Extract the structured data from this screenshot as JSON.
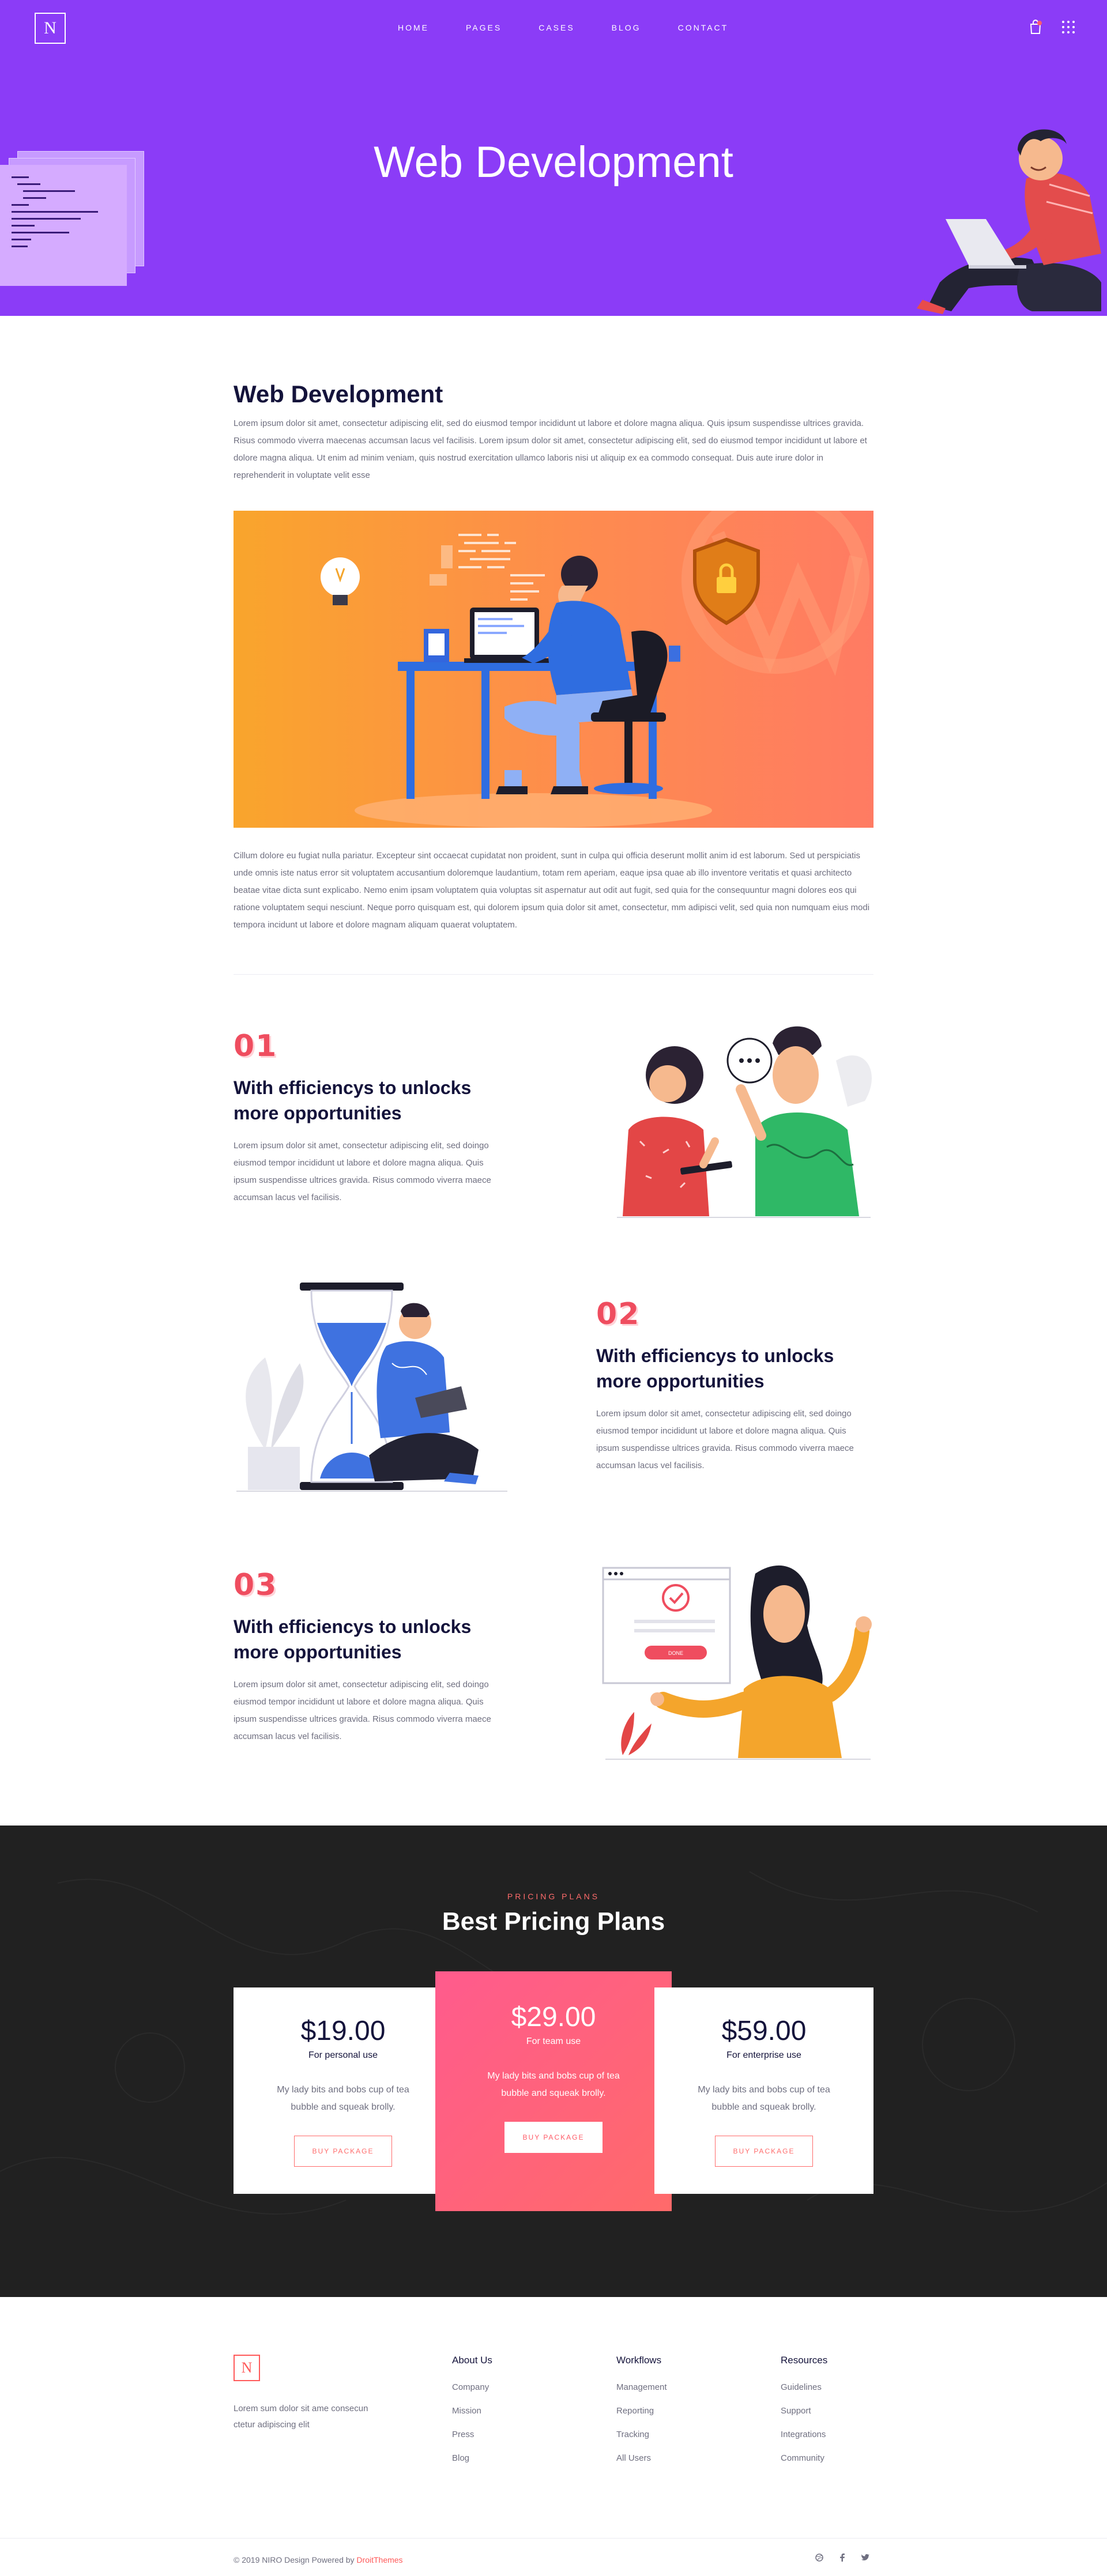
{
  "nav": {
    "logo": "N",
    "items": [
      "HOME",
      "PAGES",
      "CASES",
      "BLOG",
      "CONTACT"
    ]
  },
  "hero": {
    "title": "Web Development"
  },
  "intro": {
    "title": "Web Development",
    "paragraph": "Lorem ipsum dolor sit amet, consectetur adipiscing elit, sed do eiusmod tempor incididunt ut labore et dolore magna aliqua. Quis ipsum suspendisse ultrices gravida. Risus commodo viverra maecenas accumsan lacus vel facilisis. Lorem ipsum dolor sit amet, consectetur adipiscing elit, sed do eiusmod tempor incididunt ut labore et dolore magna aliqua. Ut enim ad minim veniam, quis nostrud exercitation ullamco laboris nisi ut aliquip ex ea commodo consequat. Duis aute irure dolor in reprehenderit in voluptate velit esse",
    "paragraph2": "Cillum dolore eu fugiat nulla pariatur. Excepteur sint occaecat cupidatat non proident, sunt in culpa qui officia deserunt mollit anim id est laborum. Sed ut perspiciatis unde omnis iste natus error sit voluptatem accusantium doloremque laudantium, totam rem aperiam, eaque ipsa quae ab illo inventore veritatis et quasi architecto beatae vitae dicta sunt explicabo. Nemo enim ipsam voluptatem quia voluptas sit aspernatur aut odit aut fugit, sed quia for the consequuntur magni dolores eos qui ratione voluptatem sequi nesciunt. Neque porro quisquam est, qui dolorem ipsum quia dolor sit amet, consectetur, mm adipisci velit, sed quia non numquam eius modi tempora incidunt ut labore et dolore magnam aliquam quaerat voluptatem."
  },
  "features": [
    {
      "number": "01",
      "title": "With efficiencys to unlocks more opportunities",
      "text": "Lorem ipsum dolor sit amet, consectetur adipiscing elit, sed doingo eiusmod tempor incididunt ut labore et dolore magna aliqua. Quis ipsum suspendisse ultrices gravida. Risus commodo viverra maece accumsan lacus vel facilisis."
    },
    {
      "number": "02",
      "title": "With efficiencys to unlocks more opportunities",
      "text": "Lorem ipsum dolor sit amet, consectetur adipiscing elit, sed doingo eiusmod tempor incididunt ut labore et dolore magna aliqua. Quis ipsum suspendisse ultrices gravida. Risus commodo viverra maece accumsan lacus vel facilisis."
    },
    {
      "number": "03",
      "title": "With efficiencys to unlocks more opportunities",
      "text": "Lorem ipsum dolor sit amet, consectetur adipiscing elit, sed doingo eiusmod tempor incididunt ut labore et dolore magna aliqua. Quis ipsum suspendisse ultrices gravida. Risus commodo viverra maece accumsan lacus vel facilisis."
    }
  ],
  "illustration_text": {
    "done_button": "DONE"
  },
  "pricing": {
    "subtitle": "PRICING PLANS",
    "title": "Best Pricing Plans",
    "plans": [
      {
        "price": "$19.00",
        "for": "For personal use",
        "desc": "My lady bits and bobs cup of tea bubble and squeak brolly.",
        "button": "BUY PACKAGE"
      },
      {
        "price": "$29.00",
        "for": "For team use",
        "desc": "My lady bits and bobs cup of tea bubble and squeak brolly.",
        "button": "BUY PACKAGE"
      },
      {
        "price": "$59.00",
        "for": "For enterprise use",
        "desc": "My lady bits and bobs cup of tea bubble and squeak brolly.",
        "button": "BUY PACKAGE"
      }
    ]
  },
  "footer": {
    "logo": "N",
    "about": "Lorem sum dolor sit ame consecun ctetur adipiscing elit",
    "columns": [
      {
        "title": "About Us",
        "links": [
          "Company",
          "Mission",
          "Press",
          "Blog"
        ]
      },
      {
        "title": "Workflows",
        "links": [
          "Management",
          "Reporting",
          "Tracking",
          "All Users"
        ]
      },
      {
        "title": "Resources",
        "links": [
          "Guidelines",
          "Support",
          "Integrations",
          "Community"
        ]
      }
    ],
    "copyright": "© 2019 NIRO Design Powered by",
    "copyright_brand": "DroitThemes",
    "social": [
      "dribbble-icon",
      "facebook-icon",
      "twitter-icon"
    ]
  },
  "colors": {
    "hero_bg": "#8b3cf7",
    "accent": "#ff5a5a",
    "dark_bg": "#212121",
    "heading": "#14133b"
  }
}
